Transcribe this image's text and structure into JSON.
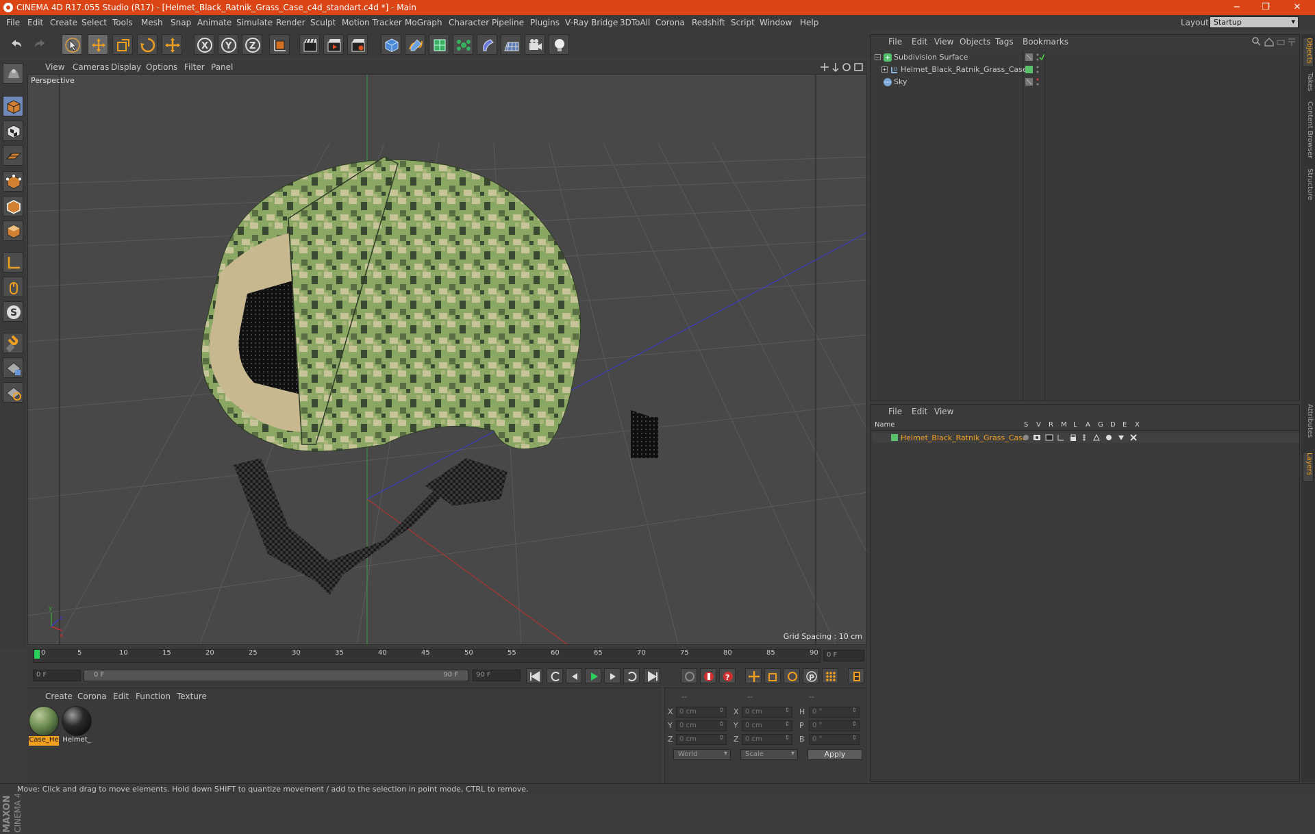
{
  "titlebar": {
    "title": "CINEMA 4D R17.055 Studio (R17) - [Helmet_Black_Ratnik_Grass_Case_c4d_standart.c4d *] - Main",
    "minimize": "−",
    "restore": "❐",
    "close": "✕"
  },
  "menubar": {
    "items": [
      "File",
      "Edit",
      "Create",
      "Select",
      "Tools",
      "Mesh",
      "Snap",
      "Animate",
      "Simulate",
      "Render",
      "Sculpt",
      "Motion Tracker",
      "MoGraph",
      "Character",
      "Pipeline",
      "Plugins",
      "V-Ray Bridge",
      "3DToAll",
      "Corona",
      "Redshift",
      "Script",
      "Window",
      "Help"
    ],
    "layout_label": "Layout:",
    "layout_value": "Startup"
  },
  "viewport": {
    "menu": [
      "View",
      "Cameras",
      "Display",
      "Options",
      "Filter",
      "Panel"
    ],
    "label": "Perspective",
    "grid_spacing": "Grid Spacing : 10 cm"
  },
  "timeline": {
    "ticks": [
      "0",
      "5",
      "10",
      "15",
      "20",
      "25",
      "30",
      "35",
      "40",
      "45",
      "50",
      "55",
      "60",
      "65",
      "70",
      "75",
      "80",
      "85",
      "90"
    ],
    "current_frame": "0 F"
  },
  "transport": {
    "start_frame": "0 F",
    "range_start": "0 F",
    "range_end": "90 F",
    "end_frame": "90 F"
  },
  "materials": {
    "menu": [
      "Create",
      "Corona",
      "Edit",
      "Function",
      "Texture"
    ],
    "items": [
      {
        "label": "Case_He",
        "selected": true
      },
      {
        "label": "Helmet_",
        "selected": false
      }
    ]
  },
  "coordinates": {
    "header": [
      "--",
      "--",
      "--"
    ],
    "rows": [
      {
        "a": "X",
        "av": "0 cm",
        "b": "X",
        "bv": "0 cm",
        "c": "H",
        "cv": "0 °"
      },
      {
        "a": "Y",
        "av": "0 cm",
        "b": "Y",
        "bv": "0 cm",
        "c": "P",
        "cv": "0 °"
      },
      {
        "a": "Z",
        "av": "0 cm",
        "b": "Z",
        "bv": "0 cm",
        "c": "B",
        "cv": "0 °"
      }
    ],
    "space": "World",
    "mode": "Scale",
    "apply": "Apply"
  },
  "object_manager": {
    "menu": [
      "File",
      "Edit",
      "View",
      "Objects",
      "Tags",
      "Bookmarks"
    ],
    "objects": [
      {
        "name": "Subdivision Surface",
        "indent": 0,
        "icon_color": "#53c26a"
      },
      {
        "name": "Helmet_Black_Ratnik_Grass_Case",
        "indent": 1,
        "icon_color": "#8fb0d8"
      },
      {
        "name": "Sky",
        "indent": 0,
        "icon_color": "#7aa3d6"
      }
    ]
  },
  "layer_manager": {
    "menu": [
      "File",
      "Edit",
      "View"
    ],
    "columns": [
      "Name",
      "S",
      "V",
      "R",
      "M",
      "L",
      "A",
      "G",
      "D",
      "E",
      "X"
    ],
    "layer_name": "Helmet_Black_Ratnik_Grass_Case",
    "layer_color": "#5bc26c"
  },
  "right_tabs": [
    "Objects",
    "Takes",
    "Content Browser",
    "Structure",
    "Attributes",
    "Layers"
  ],
  "status": {
    "text": "Move: Click and drag to move elements. Hold down SHIFT to quantize movement / add to the selection in point mode, CTRL to remove."
  },
  "colors": {
    "accent": "#db4516",
    "highlight": "#f0a01e",
    "camo_light": "#c8c49a",
    "camo_mid": "#8aa863",
    "camo_dark": "#3a4a32"
  }
}
